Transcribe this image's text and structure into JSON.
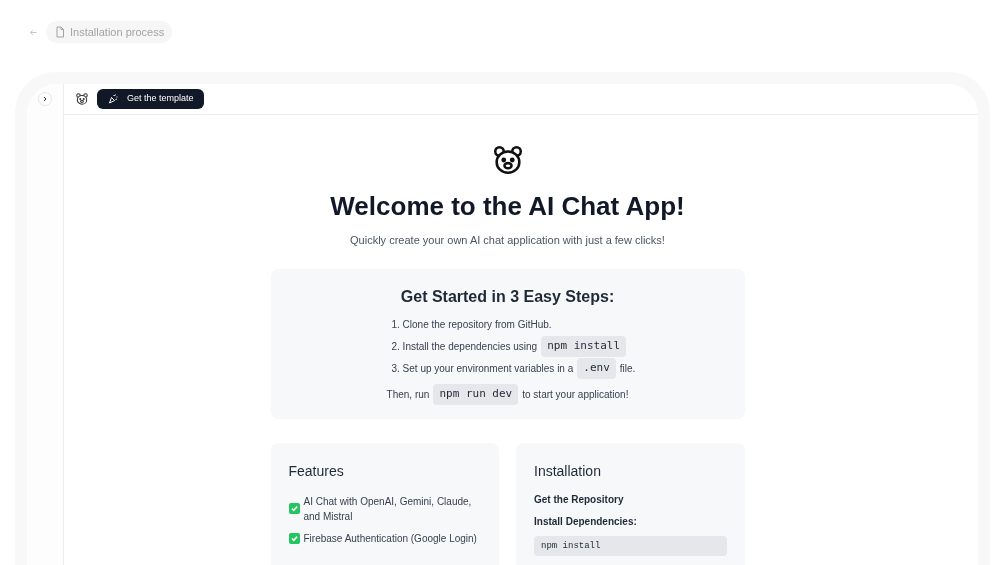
{
  "breadcrumb": {
    "label": "Installation process"
  },
  "toolbar": {
    "template_button": "Get the template"
  },
  "hero": {
    "title": "Welcome to the AI Chat App!",
    "subtitle": "Quickly create your own AI chat application with just a few clicks!"
  },
  "steps_card": {
    "title": "Get Started in 3 Easy Steps:",
    "steps": [
      [
        {
          "kind": "text",
          "text": "1. Clone the repository from GitHub."
        }
      ],
      [
        {
          "kind": "text",
          "text": "2. Install the dependencies using"
        },
        {
          "kind": "code",
          "text": "npm install"
        }
      ],
      [
        {
          "kind": "text",
          "text": "3. Set up your environment variables in a"
        },
        {
          "kind": "code",
          "text": ".env"
        },
        {
          "kind": "text",
          "text": "file."
        }
      ]
    ],
    "footer": [
      {
        "kind": "text",
        "text": "Then, run"
      },
      {
        "kind": "code",
        "text": "npm run dev"
      },
      {
        "kind": "text",
        "text": "to start your application!"
      }
    ]
  },
  "features": {
    "title": "Features",
    "items": [
      "AI Chat with OpenAI, Gemini, Claude, and Mistral",
      "Firebase Authentication (Google Login)"
    ]
  },
  "installation": {
    "title": "Installation",
    "sections": [
      {
        "kind": "heading",
        "text": "Get the Repository"
      },
      {
        "kind": "heading",
        "text": "Install Dependencies:"
      },
      {
        "kind": "code",
        "text": "npm install"
      }
    ]
  }
}
